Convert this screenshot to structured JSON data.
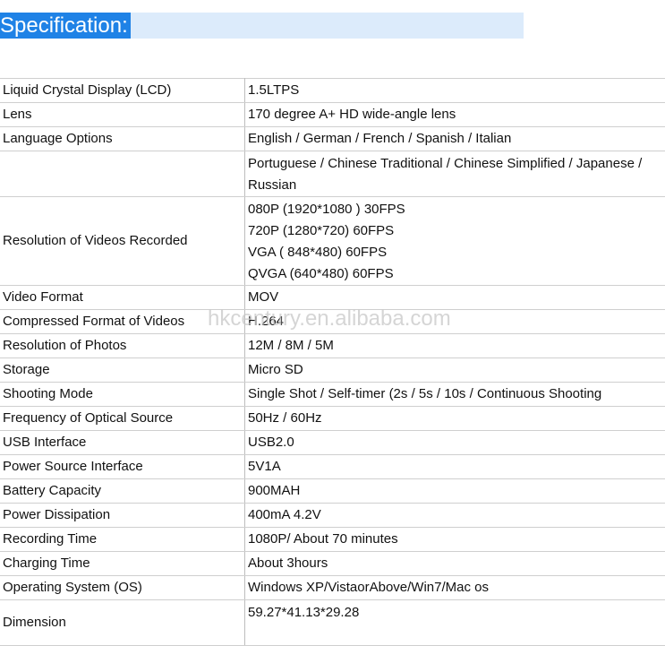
{
  "header": {
    "title": "Specification:"
  },
  "specs": [
    {
      "label": "Liquid Crystal Display (LCD)",
      "values": [
        "1.5LTPS"
      ]
    },
    {
      "label": "Lens",
      "values": [
        "170 degree A+ HD wide-angle lens"
      ]
    },
    {
      "label": "Language Options",
      "values": [
        "English / German / French / Spanish / Italian"
      ]
    },
    {
      "label": "",
      "values": [
        "Portuguese / Chinese Traditional / Chinese Simplified / Japanese /",
        "Russian"
      ]
    },
    {
      "label": "Resolution of Videos Recorded",
      "values": [
        "080P (1920*1080 ) 30FPS",
        "720P   (1280*720)   60FPS",
        "VGA   ( 848*480)   60FPS",
        "QVGA (640*480)   60FPS"
      ]
    },
    {
      "label": "Video Format",
      "values": [
        "MOV"
      ]
    },
    {
      "label": "Compressed Format of Videos",
      "values": [
        "H.264"
      ]
    },
    {
      "label": "Resolution of Photos",
      "values": [
        "12M / 8M / 5M"
      ]
    },
    {
      "label": "Storage",
      "values": [
        "Micro SD"
      ]
    },
    {
      "label": "Shooting Mode",
      "values": [
        "Single Shot / Self-timer (2s / 5s / 10s / Continuous Shooting"
      ]
    },
    {
      "label": "Frequency of Optical Source",
      "values": [
        "50Hz / 60Hz"
      ]
    },
    {
      "label": "USB Interface",
      "values": [
        "USB2.0"
      ]
    },
    {
      "label": "Power Source Interface",
      "values": [
        "5V1A"
      ]
    },
    {
      "label": "Battery Capacity",
      "values": [
        "900MAH"
      ]
    },
    {
      "label": "Power Dissipation",
      "values": [
        "400mA 4.2V"
      ]
    },
    {
      "label": "Recording Time",
      "values": [
        "1080P/ About 70 minutes"
      ]
    },
    {
      "label": "Charging Time",
      "values": [
        "About 3hours"
      ]
    },
    {
      "label": "Operating System (OS)",
      "values": [
        "Windows XP/VistaorAbove/Win7/Mac os"
      ]
    },
    {
      "label": "Dimension",
      "values": [
        "59.27*41.13*29.28",
        ""
      ]
    }
  ],
  "watermark": "hkcentury.en.alibaba.com"
}
